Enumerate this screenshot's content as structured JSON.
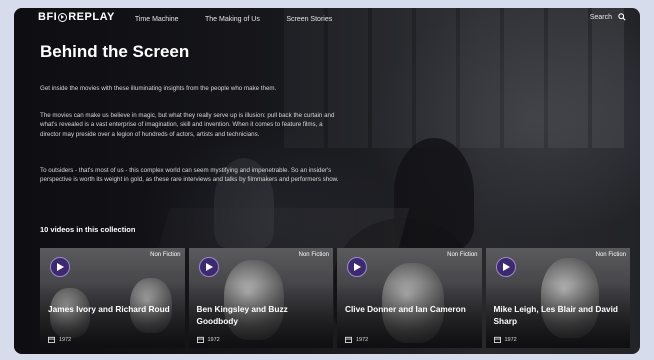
{
  "header": {
    "logo_text_left": "BFI",
    "logo_text_right": "REPLAY",
    "nav": [
      "Time Machine",
      "The Making of Us",
      "Screen Stories"
    ],
    "search_label": "Search"
  },
  "hero": {
    "title": "Behind the Screen",
    "paragraphs": [
      "Get inside the movies with these illuminating insights from the people who make them.",
      "The movies can make us believe in magic, but what they really serve up is illusion: pull back the curtain and what's revealed is a vast enterprise of imagination, skill and invention. When it comes to feature films, a director may preside over a legion of hundreds of actors, artists and technicians.",
      "To outsiders - that's most of us - this complex world can seem mystifying and impenetrable. So an insider's perspective is worth its weight in gold, as these rare interviews and talks by filmmakers and performers show."
    ]
  },
  "collection": {
    "count_label": "10 videos in this collection",
    "cards": [
      {
        "title": "James Ivory and Richard Roud",
        "badge": "Non Fiction",
        "year": "1972"
      },
      {
        "title": "Ben Kingsley and Buzz Goodbody",
        "badge": "Non Fiction",
        "year": "1972"
      },
      {
        "title": "Clive Donner and Ian Cameron",
        "badge": "Non Fiction",
        "year": "1972"
      },
      {
        "title": "Mike Leigh, Les Blair and David Sharp",
        "badge": "Non Fiction",
        "year": "1972"
      }
    ]
  },
  "colors": {
    "page_bg": "#d7dcec",
    "play_button": "#3d2a6e",
    "text": "#ffffff"
  }
}
